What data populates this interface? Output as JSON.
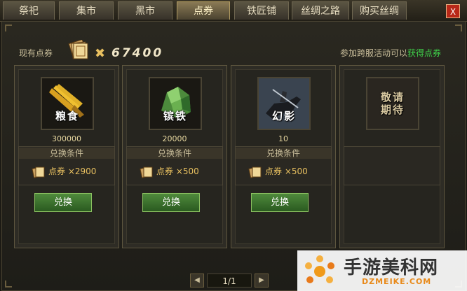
{
  "tabs": [
    {
      "label": "祭祀",
      "active": false
    },
    {
      "label": "集市",
      "active": false
    },
    {
      "label": "黑市",
      "active": false
    },
    {
      "label": "点券",
      "active": true
    },
    {
      "label": "铁匠铺",
      "active": false
    },
    {
      "label": "丝绸之路",
      "active": false
    },
    {
      "label": "购买丝绸",
      "active": false
    }
  ],
  "close_label": "X",
  "header": {
    "points_label": "现有点券",
    "ticket_icon": "ticket-bundle-icon",
    "times_symbol": "✖",
    "points_value": "67400",
    "event_prefix": "参加跨服活动可以",
    "event_link": "获得点券"
  },
  "slots": [
    {
      "name": "粮食",
      "icon": "grain-icon",
      "quantity": "300000",
      "condition_title": "兑换条件",
      "cost": "点券 ×2900",
      "button": "兑换"
    },
    {
      "name": "镔铁",
      "icon": "iron-ore-icon",
      "quantity": "20000",
      "condition_title": "兑换条件",
      "cost": "点券 ×500",
      "button": "兑换"
    },
    {
      "name": "幻影",
      "icon": "horse-rider-icon",
      "quantity": "10",
      "condition_title": "兑换条件",
      "cost": "点券 ×500",
      "button": "兑换"
    },
    {
      "name": "敬请\n期待",
      "icon": "coming-soon-icon"
    }
  ],
  "pager": {
    "prev": "◀",
    "text": "1/1",
    "next": "▶"
  },
  "watermark": {
    "text": "手游美科网",
    "sub": "DZMEIKE.COM"
  },
  "colors": {
    "accent_green": "#3fd24a",
    "gold": "#e8c060",
    "close_red": "#b82818"
  }
}
